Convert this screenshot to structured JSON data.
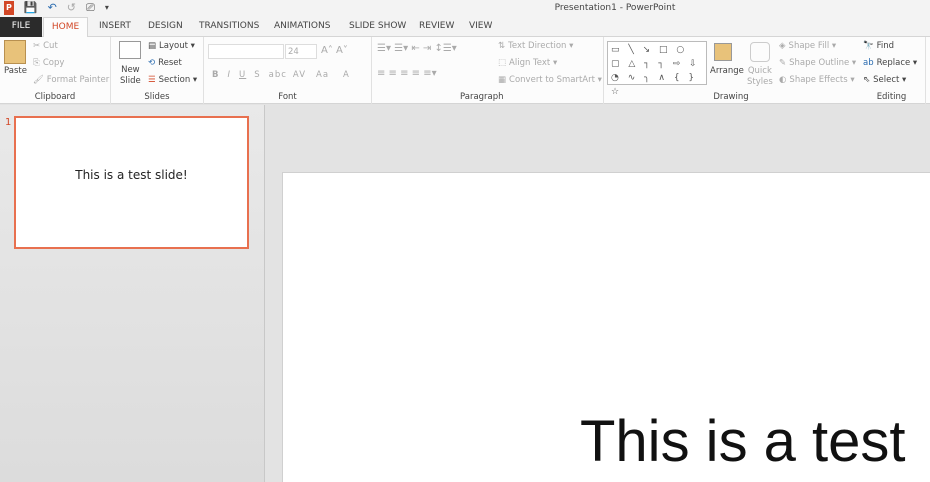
{
  "window": {
    "title": "Presentation1 - PowerPoint"
  },
  "qat": {
    "app": "P",
    "save": "💾",
    "undo": "↶",
    "redo": "↺",
    "present": "⎚",
    "more": "▾"
  },
  "tabs": [
    "FILE",
    "HOME",
    "INSERT",
    "DESIGN",
    "TRANSITIONS",
    "ANIMATIONS",
    "SLIDE SHOW",
    "REVIEW",
    "VIEW"
  ],
  "clipboard": {
    "label": "Clipboard",
    "paste": "Paste",
    "cut": "Cut",
    "copy": "Copy",
    "format_painter": "Format Painter"
  },
  "slides": {
    "label": "Slides",
    "new_slide": "New",
    "new_slide2": "Slide",
    "layout": "Layout",
    "reset": "Reset",
    "section": "Section"
  },
  "font": {
    "label": "Font",
    "font_name": "",
    "font_size": "24",
    "bold": "B",
    "italic": "I",
    "underline": "U",
    "shadow": "S",
    "strike": "abc",
    "spacing": "AV",
    "case": "Aa",
    "color": "A"
  },
  "paragraph": {
    "label": "Paragraph",
    "text_direction": "Text Direction",
    "align_text": "Align Text",
    "smartart": "Convert to SmartArt"
  },
  "drawing": {
    "label": "Drawing",
    "shapes": "▭ ╲ ↘ □ ○ ▢ △ ┐ ┐ ⇨ ⇩ ◔ ∿ ╮ ∧ { } ☆",
    "arrange": "Arrange",
    "quick": "Quick",
    "quick2": "Styles",
    "shape_fill": "Shape Fill",
    "shape_outline": "Shape Outline",
    "shape_effects": "Shape Effects"
  },
  "editing": {
    "label": "Editing",
    "find": "Find",
    "replace": "Replace",
    "select": "Select"
  },
  "thumbnails": [
    {
      "number": "1",
      "text": "This is a test slide!"
    }
  ],
  "slide": {
    "text": "This is a test"
  }
}
